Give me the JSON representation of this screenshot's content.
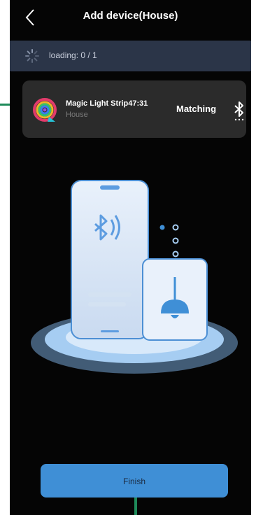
{
  "header": {
    "title": "Add device(House)",
    "back_icon": "chevron-left-icon"
  },
  "loading": {
    "label": "loading:  0 / 1",
    "icon": "spinner-icon"
  },
  "device": {
    "name": "Magic Light Strip47:31",
    "room": "House",
    "status": "Matching",
    "icon": "rainbow-ring-icon",
    "status_icon": "bluetooth-icon"
  },
  "illustration": {
    "icon": "phone-bluetooth-lamp-illustration"
  },
  "finish": {
    "label": "Finish"
  },
  "colors": {
    "background": "#050505",
    "loading_bar": "#2b3548",
    "card": "#2b2b2b",
    "accent": "#3f8fd6",
    "annotation": "#1e8a5a"
  }
}
